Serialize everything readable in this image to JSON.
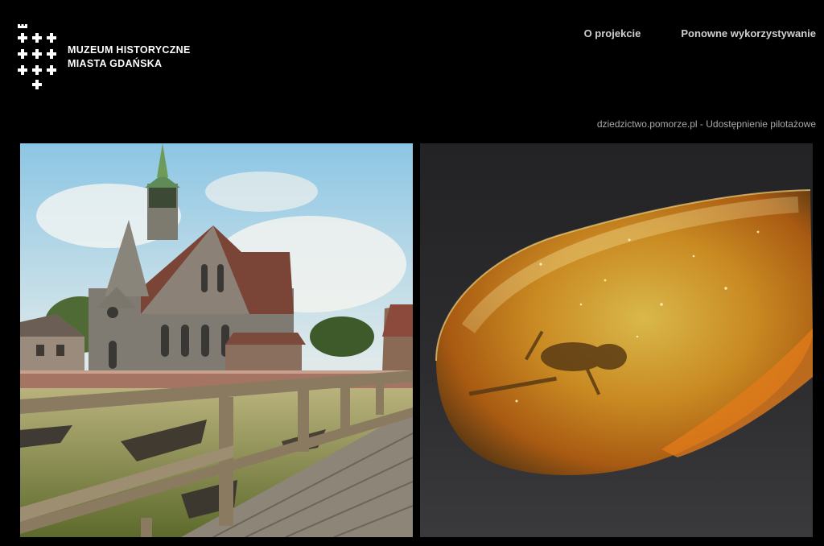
{
  "header": {
    "logo": {
      "icon": "crosses-crest-icon",
      "line1": "MUZEUM HISTORYCZNE",
      "line2": "MIASTA GDAŃSKA"
    },
    "nav": [
      {
        "label": "O projekcie"
      },
      {
        "label": "Ponowne wykorzystywanie"
      }
    ],
    "tagline": "dziedzictwo.pomorze.pl - Udostępnienie pilotażowe"
  },
  "gallery": {
    "tiles": [
      {
        "image": "church-photo"
      },
      {
        "image": "amber-photo"
      }
    ]
  },
  "colors": {
    "background": "#000000",
    "nav_text": "#cfcfcf",
    "tagline_text": "#a9a9a9"
  }
}
